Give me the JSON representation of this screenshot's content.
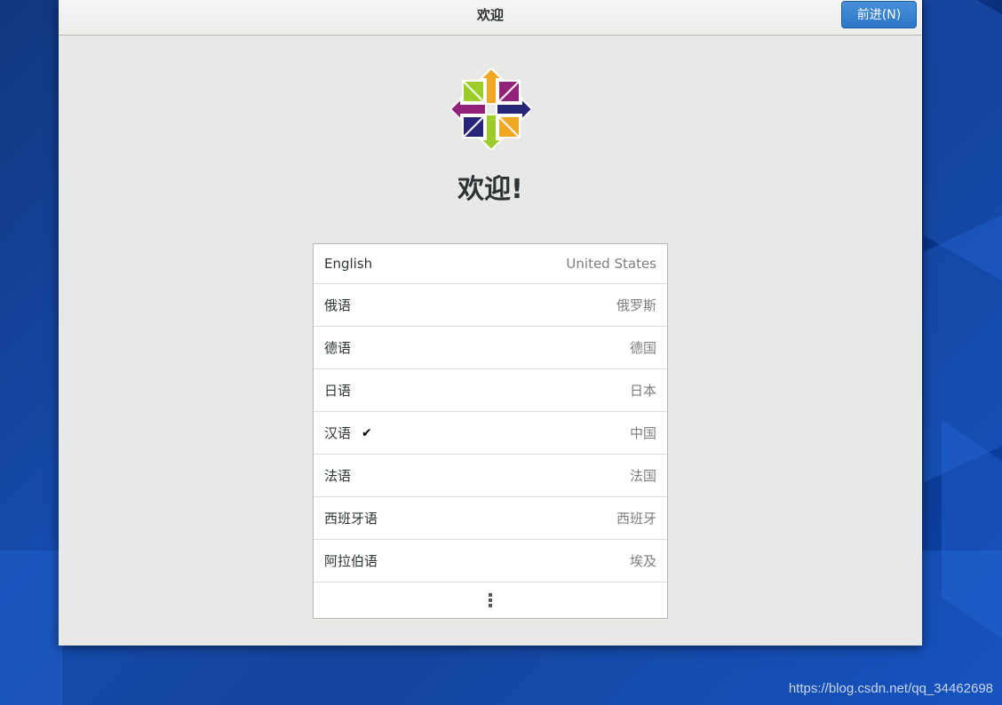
{
  "window": {
    "title": "欢迎",
    "next_button": "前进(N)"
  },
  "main": {
    "logo_icon": "centos-logo-icon",
    "welcome": "欢迎!"
  },
  "languages": [
    {
      "name": "English",
      "region": "United States",
      "selected": false
    },
    {
      "name": "俄语",
      "region": "俄罗斯",
      "selected": false
    },
    {
      "name": "德语",
      "region": "德国",
      "selected": false
    },
    {
      "name": "日语",
      "region": "日本",
      "selected": false
    },
    {
      "name": "汉语",
      "region": "中国",
      "selected": true,
      "check": "✔"
    },
    {
      "name": "法语",
      "region": "法国",
      "selected": false
    },
    {
      "name": "西班牙语",
      "region": "西班牙",
      "selected": false
    },
    {
      "name": "阿拉伯语",
      "region": "埃及",
      "selected": false
    }
  ],
  "more_icon": "vertical-ellipsis-icon",
  "watermark": "https://blog.csdn.net/qq_34462698",
  "colors": {
    "accent": "#3584e4",
    "logo_green": "#9ccd2a",
    "logo_purple": "#932279",
    "logo_orange": "#efa724",
    "logo_navy": "#262577"
  }
}
